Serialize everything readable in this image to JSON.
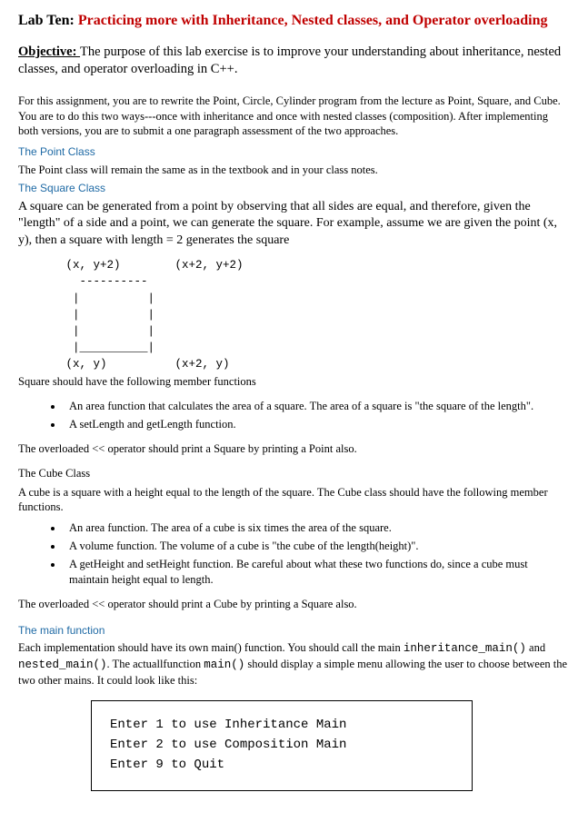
{
  "title": {
    "prefix": "Lab Ten: ",
    "suffix": "Practicing more with Inheritance, Nested classes, and Operator overloading"
  },
  "objective": {
    "label": "Objective: ",
    "text": "The purpose of this lab exercise is to improve your understanding about inheritance, nested classes, and operator overloading in C++."
  },
  "assignment_para": "For this assignment, you are to rewrite the Point, Circle, Cylinder program from the lecture as Point, Square, and Cube. You are to do this two ways---once with inheritance and once with nested classes (composition). After implementing both versions, you are to submit a one paragraph assessment of the two approaches.",
  "point": {
    "heading": "The Point Class",
    "body": "The Point class will remain the same as in the textbook and in your class notes."
  },
  "square": {
    "heading": "The Square Class",
    "intro": "A square can be generated from a point by observing that all sides are equal, and therefore, given the \"length\" of a side and a point, we can generate the square. For example, assume we are given the point (x, y), then a square with length = 2 generates the square",
    "diagram": "       (x, y+2)        (x+2, y+2)\n         ----------\n        |          |\n        |          |\n        |          |\n        |__________|\n       (x, y)          (x+2, y)",
    "after_diagram": "Square should have the following member functions",
    "bullets": [
      "An area function that calculates the area of a square. The area of a square is \"the square of the length\".",
      "A setLength and getLength function."
    ],
    "overload": "The overloaded << operator should print a Square by printing a Point also."
  },
  "cube": {
    "heading": "The Cube Class",
    "intro": "A cube is a square with a height equal to the length of the square. The Cube class should have the following member functions.",
    "bullets": [
      "An area function. The area of a cube is six times the area of the square.",
      "A volume function. The volume of a cube is \"the cube of the length(height)\".",
      "A getHeight and setHeight function. Be careful about what these two functions do, since a cube must maintain height equal to length."
    ],
    "overload": "The overloaded << operator should print a Cube by printing a Square also."
  },
  "main": {
    "heading": "The main function",
    "para_prefix": "Each implementation should have its own main() function. You should call the main ",
    "code1": "inheritance_main()",
    "para_mid1": " and ",
    "code2": "nested_main()",
    "para_mid2": ". The actuallfunction ",
    "code3": "main()",
    "para_suffix": " should display a simple menu allowing the user to choose between the two other mains. It could look like this:",
    "menu": {
      "line1": "Enter 1 to use Inheritance Main",
      "line2": "Enter 2 to use Composition Main",
      "line3": "Enter 9 to Quit"
    }
  }
}
